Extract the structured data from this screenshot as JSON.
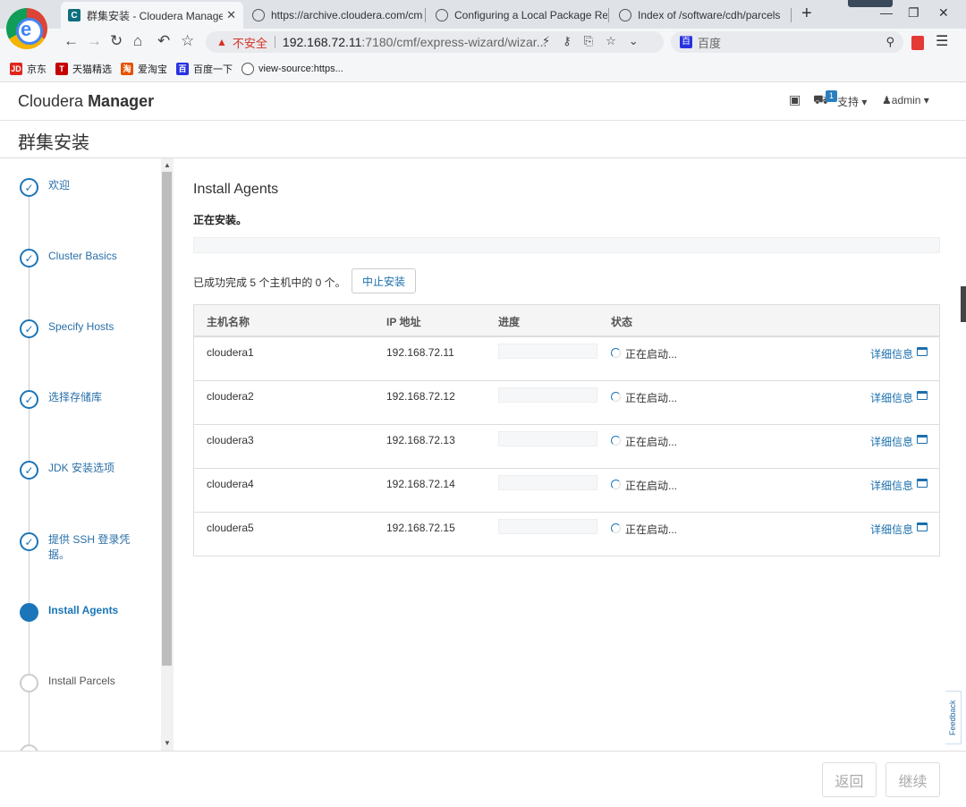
{
  "browser": {
    "tabs": [
      {
        "title": "群集安装 - Cloudera Manager",
        "active": true
      },
      {
        "title": "https://archive.cloudera.com/cm",
        "active": false
      },
      {
        "title": "Configuring a Local Package Rep",
        "active": false
      },
      {
        "title": "Index of /software/cdh/parcels",
        "active": false
      }
    ],
    "security_label": "不安全",
    "url_host": "192.168.72.11",
    "url_rest": ":7180/cmf/express-wizard/wizar...",
    "search_engine": "百度",
    "bookmarks": [
      {
        "label": "京东",
        "icon": "JD",
        "color": "#e1251b"
      },
      {
        "label": "天猫精选",
        "icon": "T",
        "color": "#c40000"
      },
      {
        "label": "爱淘宝",
        "icon": "淘",
        "color": "#e55300"
      },
      {
        "label": "百度一下",
        "icon": "百",
        "color": "#2932e1"
      },
      {
        "label": "view-source:https...",
        "icon": "globe-icon",
        "color": "#555555"
      }
    ]
  },
  "header": {
    "brand_light": "Cloudera",
    "brand_bold": "Manager",
    "support_label": "支持",
    "support_badge": "1",
    "user_label": "admin"
  },
  "page": {
    "title": "群集安装"
  },
  "steps": [
    {
      "label": "欢迎",
      "state": "done"
    },
    {
      "label": "Cluster Basics",
      "state": "done"
    },
    {
      "label": "Specify Hosts",
      "state": "done"
    },
    {
      "label": "选择存储库",
      "state": "done"
    },
    {
      "label": "JDK 安装选项",
      "state": "done"
    },
    {
      "label": "提供 SSH 登录凭据。",
      "state": "done"
    },
    {
      "label": "Install Agents",
      "state": "current"
    },
    {
      "label": "Install Parcels",
      "state": "pending"
    }
  ],
  "main": {
    "title": "Install Agents",
    "status_text": "正在安装。",
    "summary_text": "已成功完成 5 个主机中的 0 个。",
    "abort_label": "中止安装",
    "overall_progress": 0,
    "columns": [
      "主机名称",
      "IP 地址",
      "进度",
      "状态"
    ],
    "rows": [
      {
        "host": "cloudera1",
        "ip": "192.168.72.11",
        "progress": 0,
        "status": "正在启动...",
        "details": "详细信息"
      },
      {
        "host": "cloudera2",
        "ip": "192.168.72.12",
        "progress": 0,
        "status": "正在启动...",
        "details": "详细信息"
      },
      {
        "host": "cloudera3",
        "ip": "192.168.72.13",
        "progress": 0,
        "status": "正在启动...",
        "details": "详细信息"
      },
      {
        "host": "cloudera4",
        "ip": "192.168.72.14",
        "progress": 0,
        "status": "正在启动...",
        "details": "详细信息"
      },
      {
        "host": "cloudera5",
        "ip": "192.168.72.15",
        "progress": 0,
        "status": "正在启动...",
        "details": "详细信息"
      }
    ]
  },
  "footer": {
    "back_label": "返回",
    "continue_label": "继续"
  },
  "feedback_label": "Feedback",
  "colors": {
    "accent": "#1a75b9",
    "link": "#1a6fad",
    "warning": "#d93025"
  }
}
